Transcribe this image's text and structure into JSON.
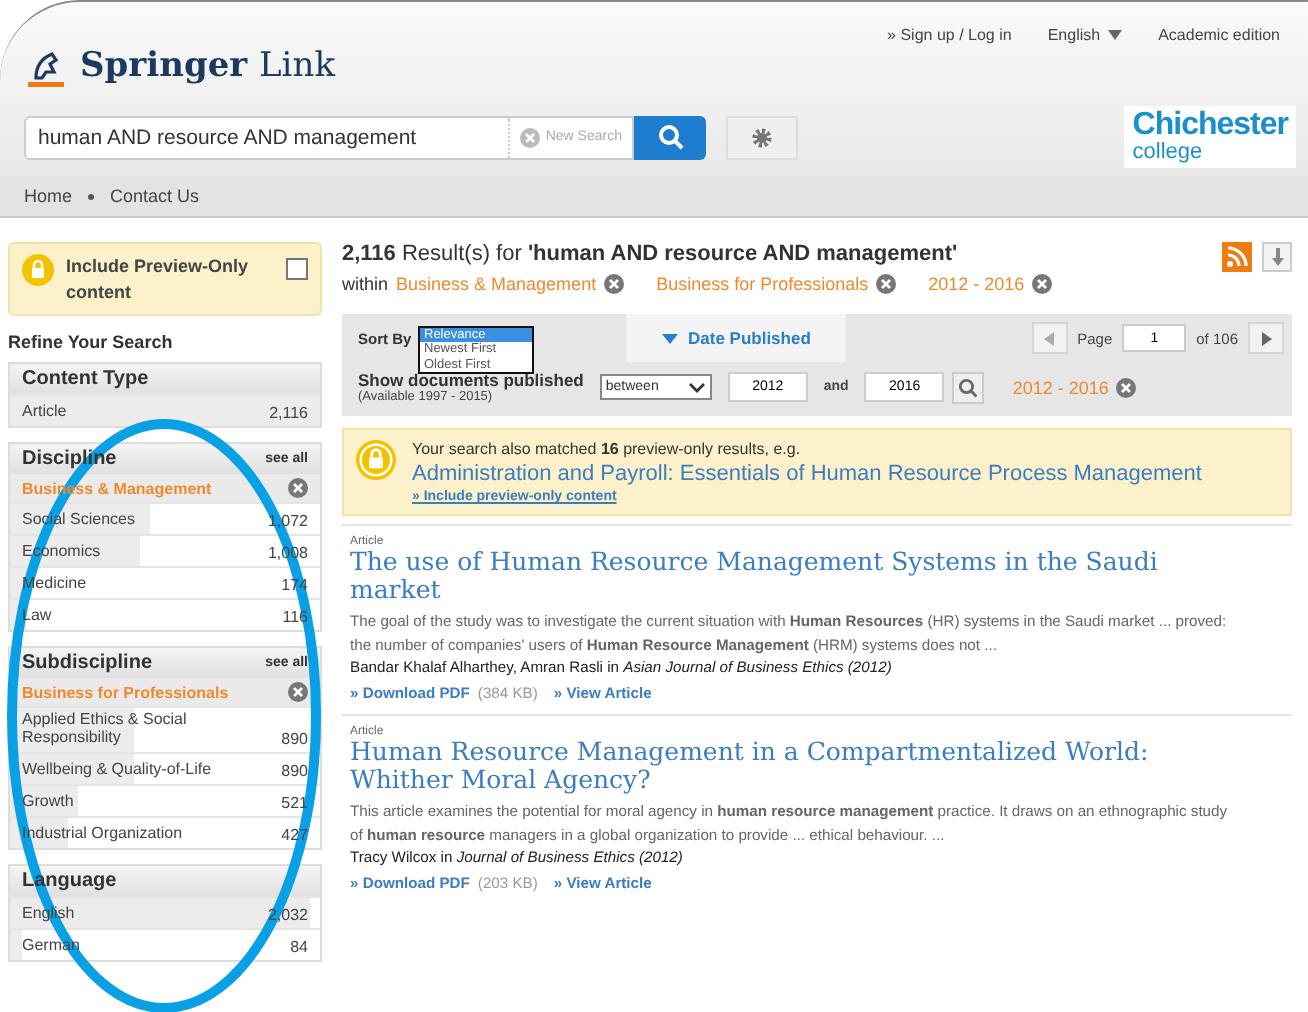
{
  "header": {
    "logo": {
      "brand": "Springer",
      "product": "Link"
    },
    "top_links": [
      {
        "label": "» Sign up / Log in",
        "kind": "link"
      },
      {
        "label": "English",
        "kind": "dropdown"
      },
      {
        "label": "Academic edition",
        "kind": "link"
      }
    ],
    "search": {
      "value": "human AND resource AND management",
      "clear_label": "New Search"
    },
    "institution_logo": {
      "line1": "Chichester",
      "line2": "college"
    }
  },
  "nav": [
    "Home",
    "Contact Us"
  ],
  "sidebar": {
    "preview_toggle": {
      "label": "Include Preview-Only content",
      "checked": false
    },
    "refine_title": "Refine Your Search",
    "facets": [
      {
        "title": "Content Type",
        "items": [
          {
            "name": "Article",
            "count": "2,116",
            "level": 1
          }
        ]
      },
      {
        "title": "Discipline",
        "see_all": "see all",
        "active_filter": "Business & Management",
        "items": [
          {
            "name": "Social Sciences",
            "count": "1,072",
            "level": 0.45
          },
          {
            "name": "Economics",
            "count": "1,008",
            "level": 0.42
          },
          {
            "name": "Medicine",
            "count": "174",
            "level": 0.07
          },
          {
            "name": "Law",
            "count": "116",
            "level": 0.05
          }
        ]
      },
      {
        "title": "Subdiscipline",
        "see_all": "see all",
        "active_filter": "Business for Professionals",
        "items": [
          {
            "name": "Applied Ethics & Social Responsibility",
            "count": "890",
            "level": 0.4
          },
          {
            "name": "Wellbeing & Quality-of-Life",
            "count": "890",
            "level": 0.4
          },
          {
            "name": "Growth",
            "count": "521",
            "level": 0.22
          },
          {
            "name": "Industrial Organization",
            "count": "427",
            "level": 0.19
          }
        ]
      },
      {
        "title": "Language",
        "items": [
          {
            "name": "English",
            "count": "2,032",
            "level": 0.97
          },
          {
            "name": "German",
            "count": "84",
            "level": 0.04
          }
        ]
      }
    ]
  },
  "results_header": {
    "summary": "**2,116** Result(s) for **'human AND resource AND management'**",
    "within": "within",
    "filters": [
      "Business & Management",
      "Business for Professionals",
      "2012 - 2016"
    ]
  },
  "sort_bar": {
    "label": "Sort By",
    "options": [
      {
        "label": "Relevance",
        "selected": true
      },
      {
        "label": "Newest First",
        "selected": false
      },
      {
        "label": "Oldest First",
        "selected": false
      }
    ],
    "date_tab": "Date Published",
    "page_label": "Page",
    "page_value": "1",
    "page_total": "of 106"
  },
  "date_filter": {
    "label": "Show documents published",
    "note": "(Available 1997 - 2015)",
    "mode": "between",
    "from": "2012",
    "and": "and",
    "to": "2016",
    "active": "2012 - 2016"
  },
  "preview_notice": {
    "text": "Your search also matched **16** preview-only results, e.g.",
    "title": "Administration and Payroll: Essentials of Human Resource Process Management",
    "include_link": "» Include preview-only content"
  },
  "results": [
    {
      "type_label": "Article",
      "title": "The use of Human Resource Management Systems in the Saudi market",
      "snippet": "The goal of the study was to investigate the current situation with **Human Resources** (HR) systems in the Saudi market ... proved: the number of companies' users of **Human Resource Management** (HRM) systems does not ...",
      "authors": "Bandar Khalaf Alharthey, Amran Rasli",
      "in": "in",
      "journal": "Asian Journal of Business Ethics (2012)",
      "download": "» Download PDF",
      "size": "(384 KB)",
      "view": "» View Article"
    },
    {
      "type_label": "Article",
      "title": "Human Resource Management in a Compartmentalized World: Whither Moral Agency?",
      "snippet": "This article examines the potential for moral agency in **human resource management** practice. It draws on an ethnographic study of **human resource** managers in a global organization to provide ... ethical behaviour. ...",
      "authors": "Tracy Wilcox",
      "in": "in",
      "journal": "Journal of Business Ethics (2012)",
      "download": "» Download PDF",
      "size": "(203 KB)",
      "view": "» View Article"
    }
  ]
}
